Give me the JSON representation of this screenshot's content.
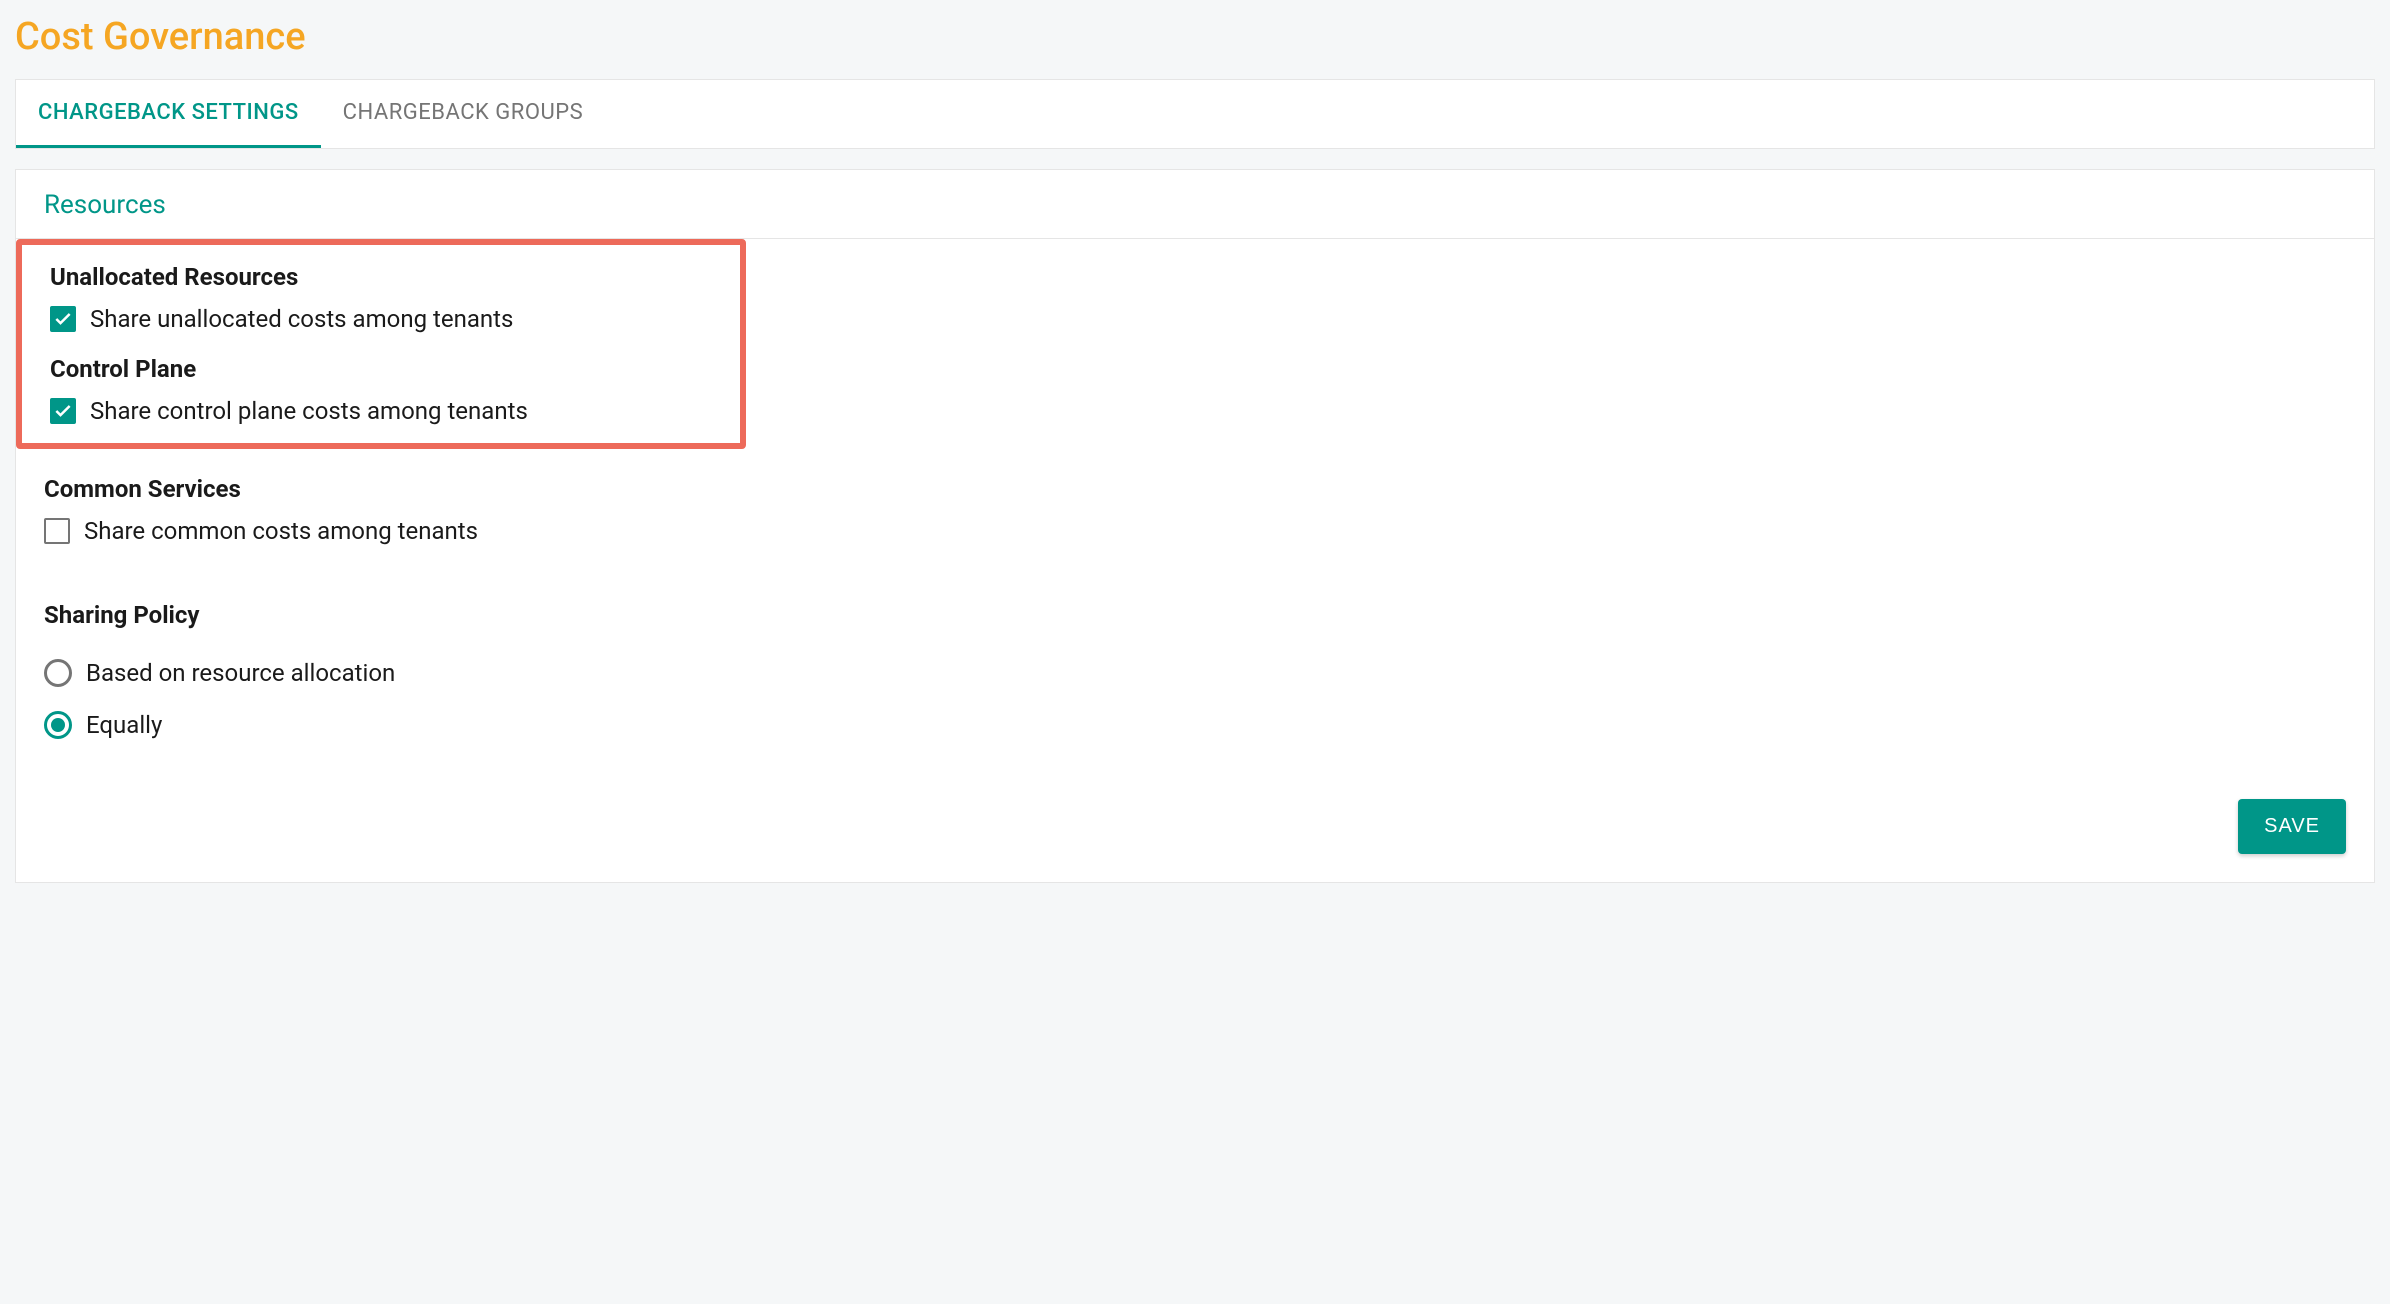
{
  "header": {
    "title": "Cost Governance"
  },
  "tabs": [
    {
      "label": "CHARGEBACK SETTINGS",
      "active": true
    },
    {
      "label": "CHARGEBACK GROUPS",
      "active": false
    }
  ],
  "section": {
    "title": "Resources"
  },
  "settings": {
    "unallocated": {
      "title": "Unallocated Resources",
      "label": "Share unallocated costs among tenants",
      "checked": true
    },
    "control_plane": {
      "title": "Control Plane",
      "label": "Share control plane costs among tenants",
      "checked": true
    },
    "common_services": {
      "title": "Common Services",
      "label": "Share common costs among tenants",
      "checked": false
    }
  },
  "sharing_policy": {
    "title": "Sharing Policy",
    "options": [
      {
        "label": "Based on resource allocation",
        "selected": false
      },
      {
        "label": "Equally",
        "selected": true
      }
    ]
  },
  "footer": {
    "save_label": "SAVE"
  }
}
